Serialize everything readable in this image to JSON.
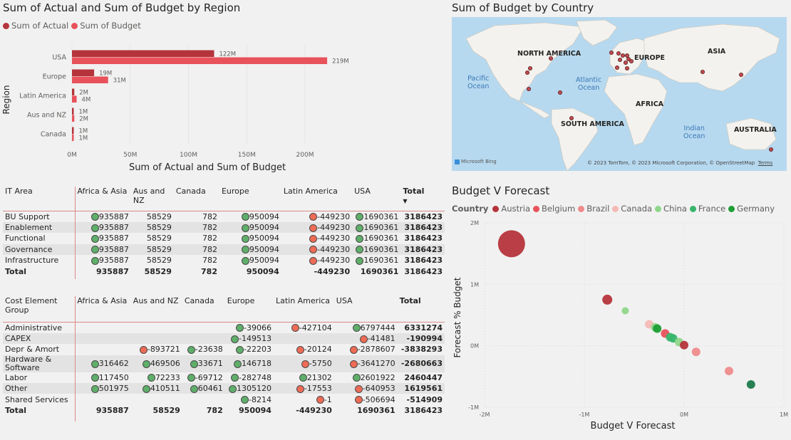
{
  "bar_chart": {
    "title": "Sum of Actual and Sum of Budget by Region",
    "legend": [
      {
        "label": "Sum of Actual",
        "color": "#b5343b"
      },
      {
        "label": "Sum of Budget",
        "color": "#e8525b"
      }
    ],
    "ylabel": "Region",
    "xlabel": "Sum of Actual and Sum of Budget",
    "x_ticks": [
      "0M",
      "50M",
      "100M",
      "150M",
      "200M"
    ]
  },
  "map": {
    "title": "Sum of Budget by Country",
    "labels": {
      "north_america": "NORTH AMERICA",
      "europe": "EUROPE",
      "asia": "ASIA",
      "pacific": "Pacific\nOcean",
      "atlantic": "Atlantic\nOcean",
      "africa": "AFRICA",
      "south_america": "SOUTH AMERICA",
      "indian": "Indian\nOcean",
      "australia": "AUSTRALIA"
    },
    "bing": "Microsoft Bing",
    "copyright": "© 2023 TomTom, © 2023 Microsoft Corporation, © OpenStreetMap",
    "terms": "Terms"
  },
  "it_table": {
    "headers": [
      "IT Area",
      "Africa & Asia",
      "Aus and NZ",
      "Canada",
      "Europe",
      "Latin America",
      "USA",
      "Total"
    ],
    "rows": [
      {
        "name": "BU Support",
        "africa": "935887",
        "aus": "58529",
        "canada": "782",
        "europe": "950094",
        "latin": "-449230",
        "usa": "1690361",
        "total": "3186423"
      },
      {
        "name": "Enablement",
        "africa": "935887",
        "aus": "58529",
        "canada": "782",
        "europe": "950094",
        "latin": "-449230",
        "usa": "1690361",
        "total": "3186423"
      },
      {
        "name": "Functional",
        "africa": "935887",
        "aus": "58529",
        "canada": "782",
        "europe": "950094",
        "latin": "-449230",
        "usa": "1690361",
        "total": "3186423"
      },
      {
        "name": "Governance",
        "africa": "935887",
        "aus": "58529",
        "canada": "782",
        "europe": "950094",
        "latin": "-449230",
        "usa": "1690361",
        "total": "3186423"
      },
      {
        "name": "Infrastructure",
        "africa": "935887",
        "aus": "58529",
        "canada": "782",
        "europe": "950094",
        "latin": "-449230",
        "usa": "1690361",
        "total": "3186423"
      }
    ],
    "total": {
      "name": "Total",
      "africa": "935887",
      "aus": "58529",
      "canada": "782",
      "europe": "950094",
      "latin": "-449230",
      "usa": "1690361",
      "total": "3186423"
    }
  },
  "cost_table": {
    "headers": [
      "Cost Element Group",
      "Africa & Asia",
      "Aus and NZ",
      "Canada",
      "Europe",
      "Latin America",
      "USA",
      "Total"
    ],
    "rows": [
      {
        "name": "Administrative",
        "africa": "",
        "aus": "",
        "canada": "",
        "europe": "-39066",
        "latin": "-427104",
        "usa": "6797444",
        "total": "6331274"
      },
      {
        "name": "CAPEX",
        "africa": "",
        "aus": "",
        "canada": "",
        "europe": "-149513",
        "latin": "",
        "usa": "-41481",
        "total": "-190994"
      },
      {
        "name": "Depr & Amort",
        "africa": "",
        "aus": "-893721",
        "canada": "-23638",
        "europe": "-22203",
        "latin": "-20124",
        "usa": "-2878607",
        "total": "-3838293"
      },
      {
        "name": "Hardware & Software",
        "africa": "316462",
        "aus": "469506",
        "canada": "33671",
        "europe": "146718",
        "latin": "-5750",
        "usa": "-3641270",
        "total": "-2680663"
      },
      {
        "name": "Labor",
        "africa": "117450",
        "aus": "72233",
        "canada": "-69712",
        "europe": "-282748",
        "latin": "21302",
        "usa": "2601922",
        "total": "2460447"
      },
      {
        "name": "Other",
        "africa": "501975",
        "aus": "410511",
        "canada": "60461",
        "europe": "1305120",
        "latin": "-17553",
        "usa": "-640953",
        "total": "1619561"
      },
      {
        "name": "Shared Services",
        "africa": "",
        "aus": "",
        "canada": "",
        "europe": "-8214",
        "latin": "-1",
        "usa": "-506694",
        "total": "-514909"
      }
    ],
    "total": {
      "name": "Total",
      "africa": "935887",
      "aus": "58529",
      "canada": "782",
      "europe": "950094",
      "latin": "-449230",
      "usa": "1690361",
      "total": "3186423"
    }
  },
  "scatter": {
    "title": "Budget V Forecast",
    "legend_label": "Country",
    "legend": [
      {
        "label": "Austria",
        "color": "#b5343b"
      },
      {
        "label": "Belgium",
        "color": "#e8525b"
      },
      {
        "label": "Brazil",
        "color": "#ee8b8b"
      },
      {
        "label": "Canada",
        "color": "#f6b9b6"
      },
      {
        "label": "China",
        "color": "#8fd68a"
      },
      {
        "label": "France",
        "color": "#38b56b"
      },
      {
        "label": "Germany",
        "color": "#1e9e35"
      }
    ],
    "more_arrow": "▶",
    "xlabel": "Budget V Forecast",
    "ylabel": "Forecast % Budget"
  },
  "colors": {
    "actual": "#b5343b",
    "budget": "#e8525b",
    "good": "#5fae6a",
    "bad": "#ee6b55"
  },
  "chart_data": [
    {
      "type": "bar",
      "title": "Sum of Actual and Sum of Budget by Region",
      "categories": [
        "USA",
        "Europe",
        "Latin America",
        "Aus and NZ",
        "Canada"
      ],
      "series": [
        {
          "name": "Sum of Actual",
          "values": [
            122,
            19,
            2,
            1,
            1
          ],
          "labels": [
            "122M",
            "19M",
            "2M",
            "1M",
            "1M"
          ]
        },
        {
          "name": "Sum of Budget",
          "values": [
            219,
            31,
            4,
            2,
            1
          ],
          "labels": [
            "219M",
            "31M",
            "4M",
            "2M",
            "1M"
          ]
        }
      ],
      "xlim": [
        0,
        230
      ],
      "xlabel": "Sum of Actual and Sum of Budget",
      "ylabel": "Region",
      "legend": "top-left"
    },
    {
      "type": "scatter",
      "title": "Budget V Forecast",
      "xlabel": "Budget V Forecast",
      "ylabel": "Forecast % Budget",
      "x_ticks": [
        "-2M",
        "-1M",
        "0M",
        "1M"
      ],
      "y_ticks": [
        "2M",
        "1M",
        "0M",
        "-1M"
      ],
      "xlim": [
        -2,
        1
      ],
      "ylim": [
        -1,
        2
      ],
      "points": [
        {
          "x": -1.73,
          "y": 1.66,
          "r": 19,
          "color": "#b5343b"
        },
        {
          "x": -0.77,
          "y": 0.75,
          "r": 7,
          "color": "#b5343b"
        },
        {
          "x": -0.59,
          "y": 0.57,
          "r": 5,
          "color": "#8fd68a"
        },
        {
          "x": -0.35,
          "y": 0.35,
          "r": 6,
          "color": "#f6b9b6"
        },
        {
          "x": -0.29,
          "y": 0.3,
          "r": 6,
          "color": "#8fd68a"
        },
        {
          "x": -0.27,
          "y": 0.28,
          "r": 6,
          "color": "#1e9e35"
        },
        {
          "x": -0.19,
          "y": 0.2,
          "r": 6,
          "color": "#e8525b"
        },
        {
          "x": -0.14,
          "y": 0.14,
          "r": 6,
          "color": "#38b56b"
        },
        {
          "x": -0.11,
          "y": 0.12,
          "r": 6,
          "color": "#38b56b"
        },
        {
          "x": -0.05,
          "y": 0.06,
          "r": 6,
          "color": "#8fd68a"
        },
        {
          "x": 0.0,
          "y": 0.01,
          "r": 6,
          "color": "#b5343b"
        },
        {
          "x": 0.12,
          "y": -0.1,
          "r": 6,
          "color": "#ee8b8b"
        },
        {
          "x": 0.45,
          "y": -0.41,
          "r": 6,
          "color": "#ee8b8b"
        },
        {
          "x": 0.67,
          "y": -0.63,
          "r": 6,
          "color": "#1e7a4a"
        }
      ]
    }
  ]
}
